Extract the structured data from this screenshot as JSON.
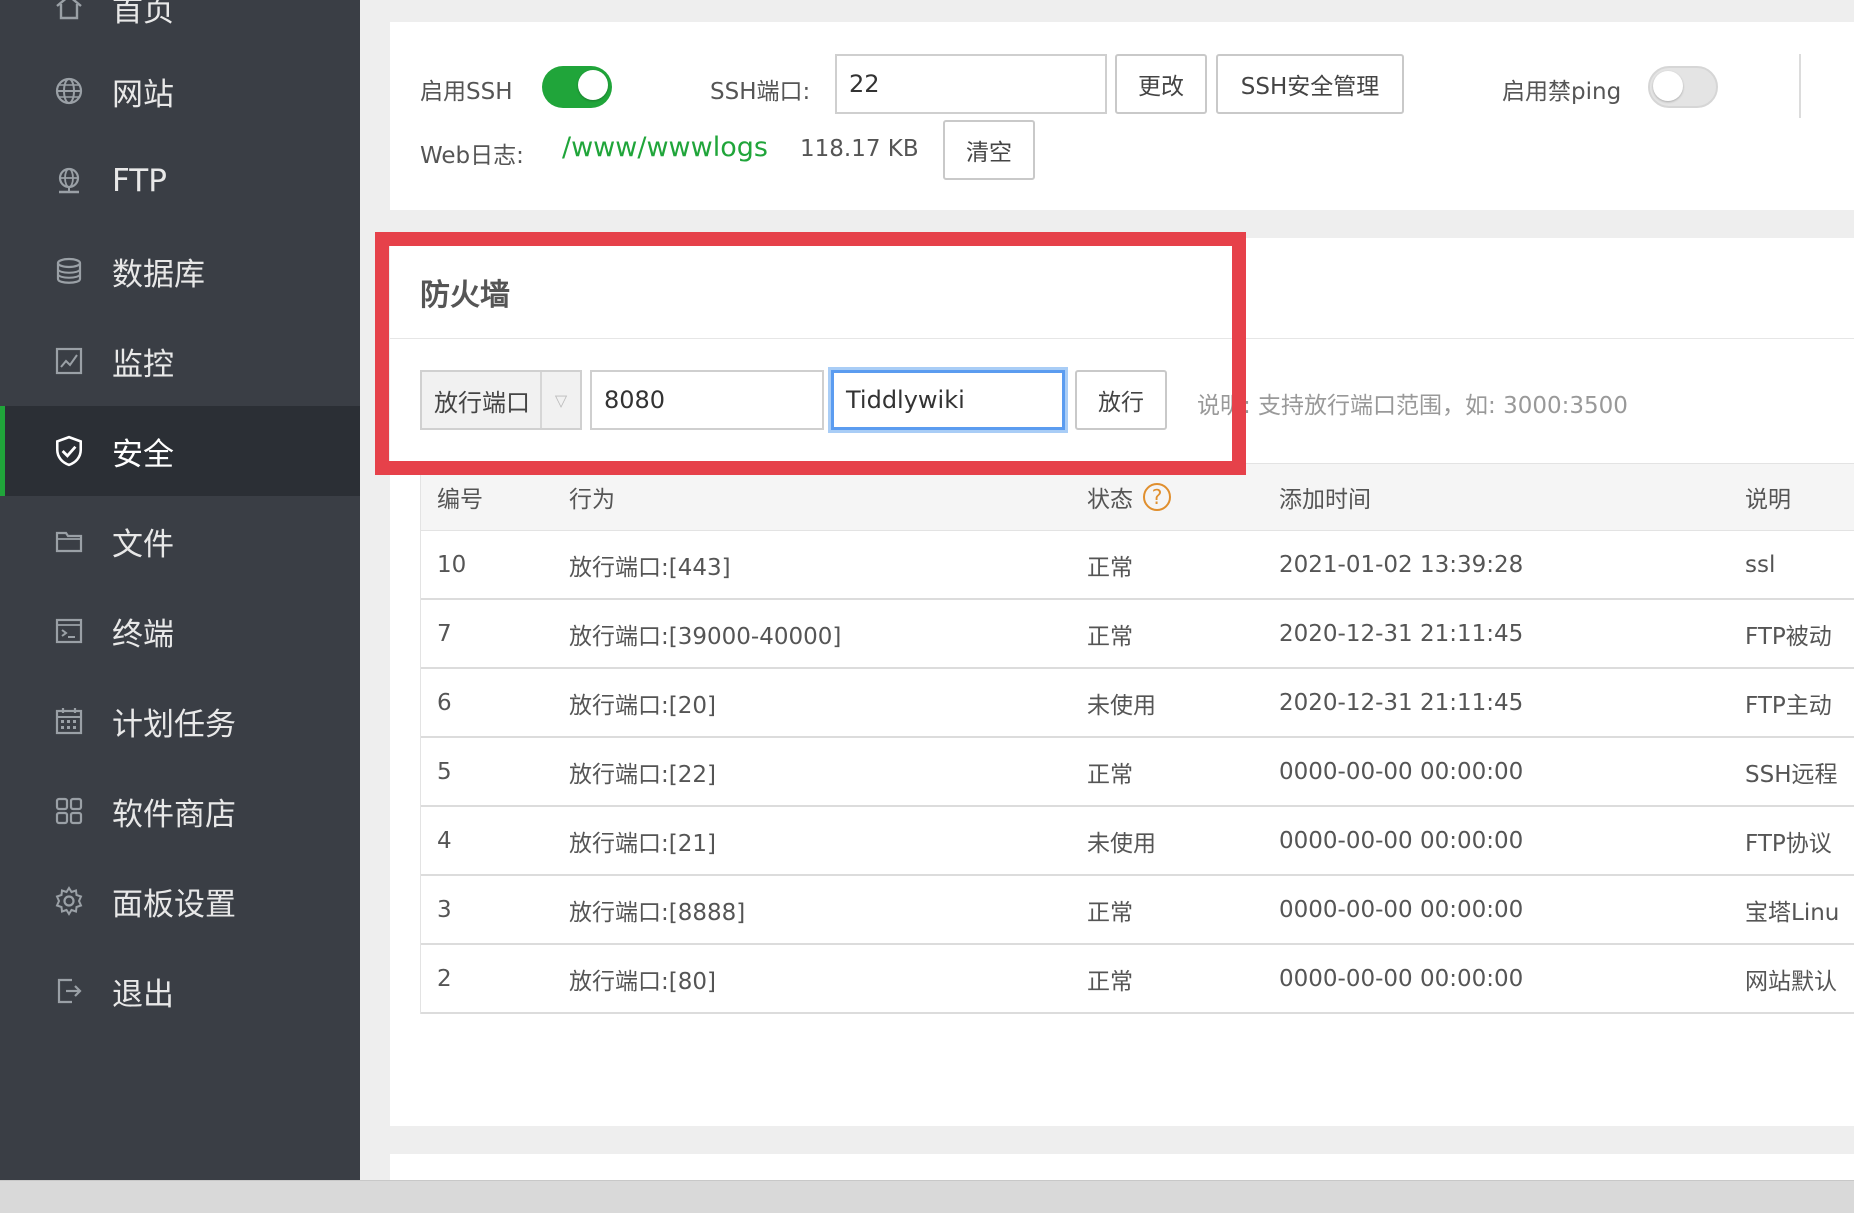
{
  "sidebar": {
    "items": [
      {
        "label": "首页",
        "icon": "home-icon"
      },
      {
        "label": "网站",
        "icon": "globe-icon"
      },
      {
        "label": "FTP",
        "icon": "ftp-icon"
      },
      {
        "label": "数据库",
        "icon": "database-icon"
      },
      {
        "label": "监控",
        "icon": "monitor-icon"
      },
      {
        "label": "安全",
        "icon": "shield-icon",
        "active": true
      },
      {
        "label": "文件",
        "icon": "folder-icon"
      },
      {
        "label": "终端",
        "icon": "terminal-icon"
      },
      {
        "label": "计划任务",
        "icon": "calendar-icon"
      },
      {
        "label": "软件商店",
        "icon": "apps-grid-icon"
      },
      {
        "label": "面板设置",
        "icon": "gear-icon"
      },
      {
        "label": "退出",
        "icon": "logout-icon"
      }
    ]
  },
  "top": {
    "ssh_enable_label": "启用SSH",
    "ssh_enabled": true,
    "ssh_port_label": "SSH端口:",
    "ssh_port_value": "22",
    "change_button": "更改",
    "ssh_security_button": "SSH安全管理",
    "ping_label": "启用禁ping",
    "ping_enabled": false,
    "weblog_label": "Web日志:",
    "weblog_path": "/www/wwwlogs",
    "weblog_size": "118.17 KB",
    "clear_button": "清空"
  },
  "firewall": {
    "title": "防火墙",
    "select_value": "放行端口",
    "port_value": "8080",
    "desc_value": "Tiddlywiki",
    "allow_button": "放行",
    "hint": "说明: 支持放行端口范围，如: 3000:3500",
    "columns": [
      "编号",
      "行为",
      "状态",
      "添加时间",
      "说明"
    ],
    "status_help_icon": "question-icon",
    "rows": [
      {
        "id": "10",
        "action": "放行端口:[443]",
        "status": "正常",
        "time": "2021-01-02 13:39:28",
        "note": "ssl"
      },
      {
        "id": "7",
        "action": "放行端口:[39000-40000]",
        "status": "正常",
        "time": "2020-12-31 21:11:45",
        "note": "FTP被动"
      },
      {
        "id": "6",
        "action": "放行端口:[20]",
        "status": "未使用",
        "time": "2020-12-31 21:11:45",
        "note": "FTP主动"
      },
      {
        "id": "5",
        "action": "放行端口:[22]",
        "status": "正常",
        "time": "0000-00-00 00:00:00",
        "note": "SSH远程"
      },
      {
        "id": "4",
        "action": "放行端口:[21]",
        "status": "未使用",
        "time": "0000-00-00 00:00:00",
        "note": "FTP协议"
      },
      {
        "id": "3",
        "action": "放行端口:[8888]",
        "status": "正常",
        "time": "0000-00-00 00:00:00",
        "note": "宝塔Linu"
      },
      {
        "id": "2",
        "action": "放行端口:[80]",
        "status": "正常",
        "time": "0000-00-00 00:00:00",
        "note": "网站默认"
      }
    ]
  },
  "colors": {
    "accent": "#20a53a",
    "highlight": "#e6414a",
    "sidebar_bg": "#3a3e45",
    "link": "#20a53a",
    "help": "#e08f2e",
    "focus": "#5b9cf0"
  }
}
